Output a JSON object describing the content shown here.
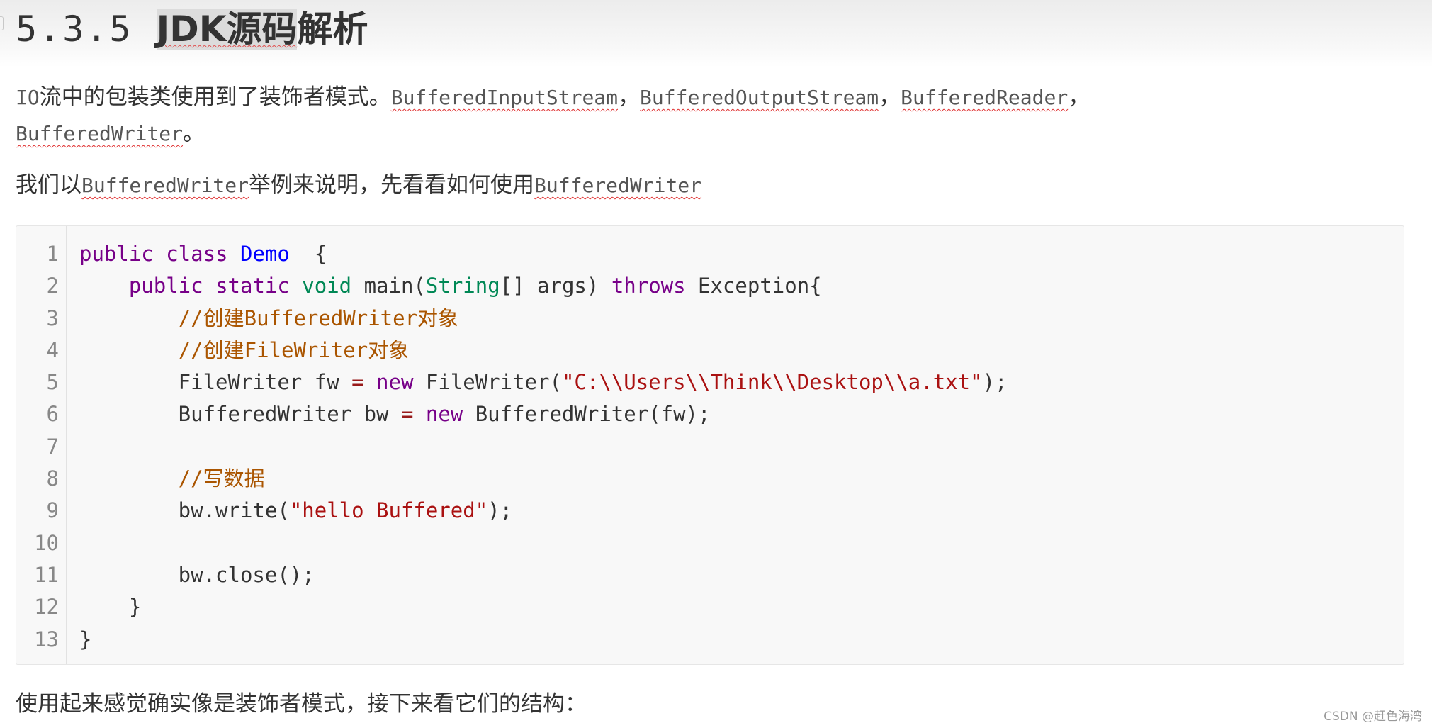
{
  "heading": {
    "number": "5.3.5 ",
    "text_selected": "JDK源码",
    "text_rest": "解析"
  },
  "para1": {
    "prefix": "IO",
    "text": "流中的包装类使用到了装饰者模式。",
    "class1": "BufferedInputStream",
    "sep1": "，",
    "class2": "BufferedOutputStream",
    "sep2": "，",
    "class3": "BufferedReader",
    "sep3": "，",
    "class4": "BufferedWriter",
    "end": "。"
  },
  "para2": {
    "t1": "我们以",
    "class1": "BufferedWriter",
    "t2": "举例来说明，先看看如何使用",
    "class2": "BufferedWriter"
  },
  "code": {
    "lines": [
      {
        "n": "1",
        "tokens": [
          [
            "k",
            "public "
          ],
          [
            "k",
            "class "
          ],
          [
            "t",
            "Demo"
          ],
          [
            "",
            "  {"
          ]
        ]
      },
      {
        "n": "2",
        "tokens": [
          [
            "",
            "    "
          ],
          [
            "k",
            "public "
          ],
          [
            "k",
            "static "
          ],
          [
            "v",
            "void "
          ],
          [
            "",
            "main("
          ],
          [
            "v",
            "String"
          ],
          [
            "",
            "[] args) "
          ],
          [
            "k",
            "throws "
          ],
          [
            "",
            "Exception{"
          ]
        ]
      },
      {
        "n": "3",
        "tokens": [
          [
            "",
            "        "
          ],
          [
            "c",
            "//创建BufferedWriter对象"
          ]
        ]
      },
      {
        "n": "4",
        "tokens": [
          [
            "",
            "        "
          ],
          [
            "c",
            "//创建FileWriter对象"
          ]
        ]
      },
      {
        "n": "5",
        "tokens": [
          [
            "",
            "        FileWriter fw "
          ],
          [
            "o",
            "= "
          ],
          [
            "k",
            "new "
          ],
          [
            "",
            "FileWriter("
          ],
          [
            "s",
            "\"C:\\\\Users\\\\Think\\\\Desktop\\\\a.txt\""
          ],
          [
            "",
            ");"
          ]
        ]
      },
      {
        "n": "6",
        "tokens": [
          [
            "",
            "        BufferedWriter bw "
          ],
          [
            "o",
            "= "
          ],
          [
            "k",
            "new "
          ],
          [
            "",
            "BufferedWriter(fw);"
          ]
        ]
      },
      {
        "n": "7",
        "tokens": []
      },
      {
        "n": "8",
        "tokens": [
          [
            "",
            "        "
          ],
          [
            "c",
            "//写数据"
          ]
        ]
      },
      {
        "n": "9",
        "tokens": [
          [
            "",
            "        bw.write("
          ],
          [
            "s",
            "\"hello Buffered\""
          ],
          [
            "",
            ");"
          ]
        ]
      },
      {
        "n": "10",
        "tokens": []
      },
      {
        "n": "11",
        "tokens": [
          [
            "",
            "        bw.close();"
          ]
        ]
      },
      {
        "n": "12",
        "tokens": [
          [
            "",
            "    }"
          ]
        ]
      },
      {
        "n": "13",
        "tokens": [
          [
            "",
            "}"
          ]
        ]
      }
    ]
  },
  "para3": {
    "text": "使用起来感觉确实像是装饰者模式，接下来看它们的结构："
  },
  "watermark": {
    "text": "CSDN @赶色海湾"
  }
}
